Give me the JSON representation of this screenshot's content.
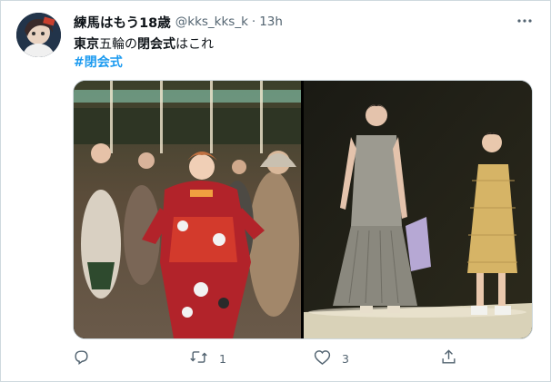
{
  "tweet": {
    "display_name": "練馬はもう18歳",
    "handle": "@kks_kks_k",
    "separator": "·",
    "time": "13h",
    "text_parts": [
      {
        "text": "東京",
        "bold": true
      },
      {
        "text": "五輪の",
        "bold": false
      },
      {
        "text": "閉会式",
        "bold": true
      },
      {
        "text": "はこれ",
        "bold": false
      }
    ],
    "hashtag": "#閉会式"
  },
  "actions": {
    "reply": {
      "icon": "reply-icon",
      "count": ""
    },
    "retweet": {
      "icon": "retweet-icon",
      "count": "1"
    },
    "like": {
      "icon": "heart-icon",
      "count": "3"
    },
    "share": {
      "icon": "share-icon",
      "count": ""
    }
  },
  "media": {
    "photos": [
      {
        "name": "closing-ceremony-dancers-photo"
      },
      {
        "name": "closing-ceremony-stage-photo"
      }
    ]
  },
  "colors": {
    "link": "#1d9bf0",
    "muted": "#536471",
    "border": "#cfd9de"
  }
}
